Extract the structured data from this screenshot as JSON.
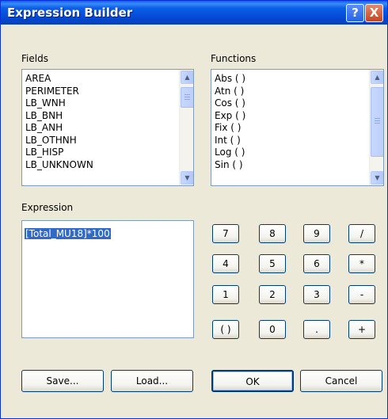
{
  "window": {
    "title": "Expression Builder",
    "help_glyph": "?",
    "close_glyph": "X"
  },
  "fields": {
    "label": "Fields",
    "items": [
      "AREA",
      "PERIMETER",
      "LB_WNH",
      "LB_BNH",
      "LB_ANH",
      "LB_OTHNH",
      "LB_HISP",
      "LB_UNKNOWN"
    ]
  },
  "functions": {
    "label": "Functions",
    "items": [
      "Abs ( )",
      "Atn ( )",
      "Cos ( )",
      "Exp ( )",
      "Fix ( )",
      "Int ( )",
      "Log ( )",
      "Sin ( )"
    ]
  },
  "expression": {
    "label": "Expression",
    "value": "[Total_MU18]*100"
  },
  "keypad": {
    "keys": [
      "7",
      "8",
      "9",
      "/",
      "4",
      "5",
      "6",
      "*",
      "1",
      "2",
      "3",
      "-",
      "( )",
      "0",
      ".",
      "+"
    ]
  },
  "buttons": {
    "save": "Save...",
    "load": "Load...",
    "ok": "OK",
    "cancel": "Cancel"
  },
  "colors": {
    "titlebar": "#0a5cf0",
    "dialog_bg": "#ece9d8",
    "selection": "#316ac5",
    "close": "#c4451d"
  },
  "icons": {
    "scroll_up": "triangle-up",
    "scroll_down": "triangle-down"
  }
}
